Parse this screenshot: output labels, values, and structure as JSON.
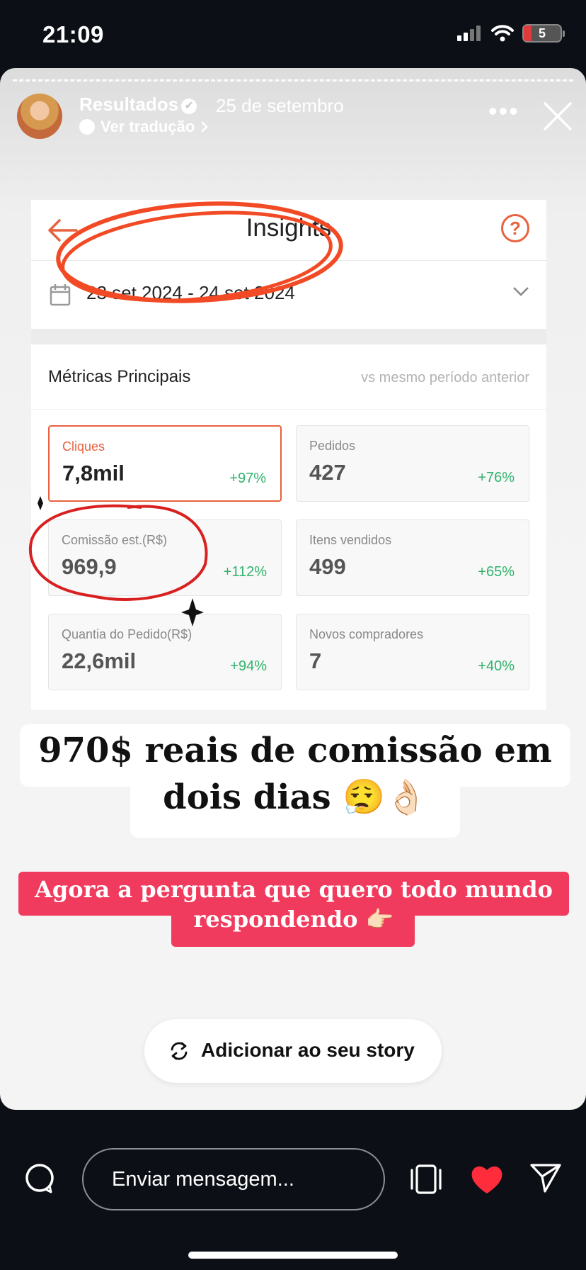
{
  "status_bar": {
    "time": "21:09",
    "battery_level": "5"
  },
  "story": {
    "username": "Resultados",
    "date": "25 de setembro",
    "translate_label": "Ver tradução"
  },
  "insights": {
    "title": "Insights",
    "help_symbol": "?",
    "date_range": "23 set 2024 - 24 set 2024",
    "metrics_title": "Métricas Principais",
    "metrics_compare": "vs mesmo período anterior",
    "tiles": [
      {
        "label": "Cliques",
        "value": "7,8mil",
        "change": "+97%"
      },
      {
        "label": "Pedidos",
        "value": "427",
        "change": "+76%"
      },
      {
        "label": "Comissão est.(R$)",
        "value": "969,9",
        "change": "+112%"
      },
      {
        "label": "Itens vendidos",
        "value": "499",
        "change": "+65%"
      },
      {
        "label": "Quantia do Pedido(R$)",
        "value": "22,6mil",
        "change": "+94%"
      },
      {
        "label": "Novos compradores",
        "value": "7",
        "change": "+40%"
      }
    ]
  },
  "caption": {
    "line1": "970$ reais de comissão em",
    "line2": "dois dias 😮‍💨👌🏻"
  },
  "question": {
    "line1": "Agora a pergunta que quero todo mundo",
    "line2": "respondendo 👉🏻"
  },
  "add_story_label": "Adicionar ao seu story",
  "message_placeholder": "Enviar mensagem...",
  "colors": {
    "accent": "#e8623f",
    "positive": "#2fb36b",
    "pink": "#f13b5e",
    "heart": "#ff2d3c"
  }
}
